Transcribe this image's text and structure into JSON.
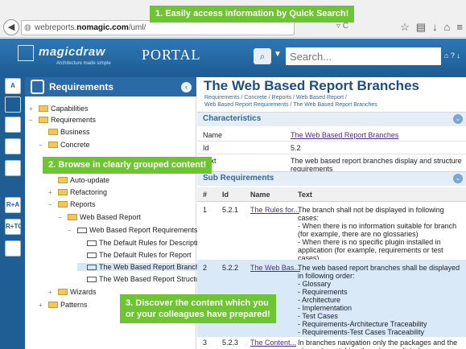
{
  "browser": {
    "url_prefix": "webreports.",
    "url_domain": "nomagic.com",
    "url_path": "/uml/",
    "url_tail": "▿ C"
  },
  "header": {
    "logo_text": "magicdraw",
    "logo_tagline": "Architecture made simple",
    "portal_title": "PORTAL",
    "search_placeholder": "Search...",
    "right_icons": "⌂ ? ↓"
  },
  "sidebar_strip": [
    "A",
    "",
    "",
    "",
    "",
    "R+A",
    "R+TC",
    ""
  ],
  "tree": {
    "title": "Requirements",
    "nodes": [
      {
        "label": "Capabilities",
        "kind": "folder",
        "fold": "+"
      },
      {
        "label": "Requirements",
        "kind": "folder",
        "fold": "−"
      },
      {
        "label": "Business",
        "kind": "folder",
        "fold": ""
      },
      {
        "label": "Concrete",
        "kind": "folder",
        "fold": "−"
      },
      {
        "label": "Auto-update",
        "kind": "folder",
        "fold": ""
      },
      {
        "label": "Refactoring",
        "kind": "folder",
        "fold": "+"
      },
      {
        "label": "Reports",
        "kind": "folder",
        "fold": "−"
      },
      {
        "label": "Web Based Report",
        "kind": "folder",
        "fold": "−"
      },
      {
        "label": "Web Based Report Requirements",
        "kind": "req",
        "fold": "−"
      },
      {
        "label": "The Default Rules for Description",
        "kind": "req",
        "fold": ""
      },
      {
        "label": "The Default Rules for Report",
        "kind": "req",
        "fold": ""
      },
      {
        "label": "The Web Based Report Branches",
        "kind": "req",
        "fold": ""
      },
      {
        "label": "The Web Based Report Structure",
        "kind": "req",
        "fold": ""
      },
      {
        "label": "Wizards",
        "kind": "folder",
        "fold": "+"
      },
      {
        "label": "Patterns",
        "kind": "folder",
        "fold": "+"
      }
    ]
  },
  "content": {
    "title": "The Web Based Report Branches",
    "breadcrumb_line1": "Requirements / Concrete / Reports / Web Based Report /",
    "breadcrumb_line2": "Web Based Report Requirements / The Web Based Report Branches",
    "characteristics_title": "Characteristics",
    "characteristics": [
      {
        "label": "Name",
        "value": "The Web Based Report Branches"
      },
      {
        "label": "Id",
        "value": "5.2"
      },
      {
        "label": "Text",
        "value": "The web based report branches display and structure requirements"
      }
    ],
    "subreq_title": "Sub Requirements",
    "table_headers": [
      "#",
      "Id",
      "Name",
      "Text"
    ],
    "rows": [
      {
        "num": "1",
        "id": "5.2.1",
        "name": "The Rules for...",
        "text": "The branch shall not be displayed in following cases:\n- When there is no information suitable for branch (for example, there are no glossaries)\n- When there is no specific plugin installed in application (for example, requirements or test cases)"
      },
      {
        "num": "2",
        "id": "5.2.2",
        "name": "The Web Bas...",
        "text": "The web based report branches shall be displayed in following order:\n- Glossary\n- Requirements\n- Architecture\n- Implementation\n- Test Cases\n- Requirements-Architecture Traceability\n- Requirements-Test Cases Traceability"
      },
      {
        "num": "3",
        "id": "5.2.3",
        "name": "The Content...",
        "text": "In branches navigation only the packages and the elements matching the rules are listed"
      }
    ]
  },
  "callouts": {
    "c1_num": "1.",
    "c1_text": "Easily access information by Quick Search!",
    "c2_num": "2.",
    "c2_text": "Browse in clearly grouped content!",
    "c3_num": "3.",
    "c3_line1": "Discover the content which you",
    "c3_line2": "or your colleagues have prepared!"
  },
  "colors": {
    "accent": "#2a6aa6",
    "callout": "#6ec532",
    "row_highlight": "#d9e9f7"
  }
}
